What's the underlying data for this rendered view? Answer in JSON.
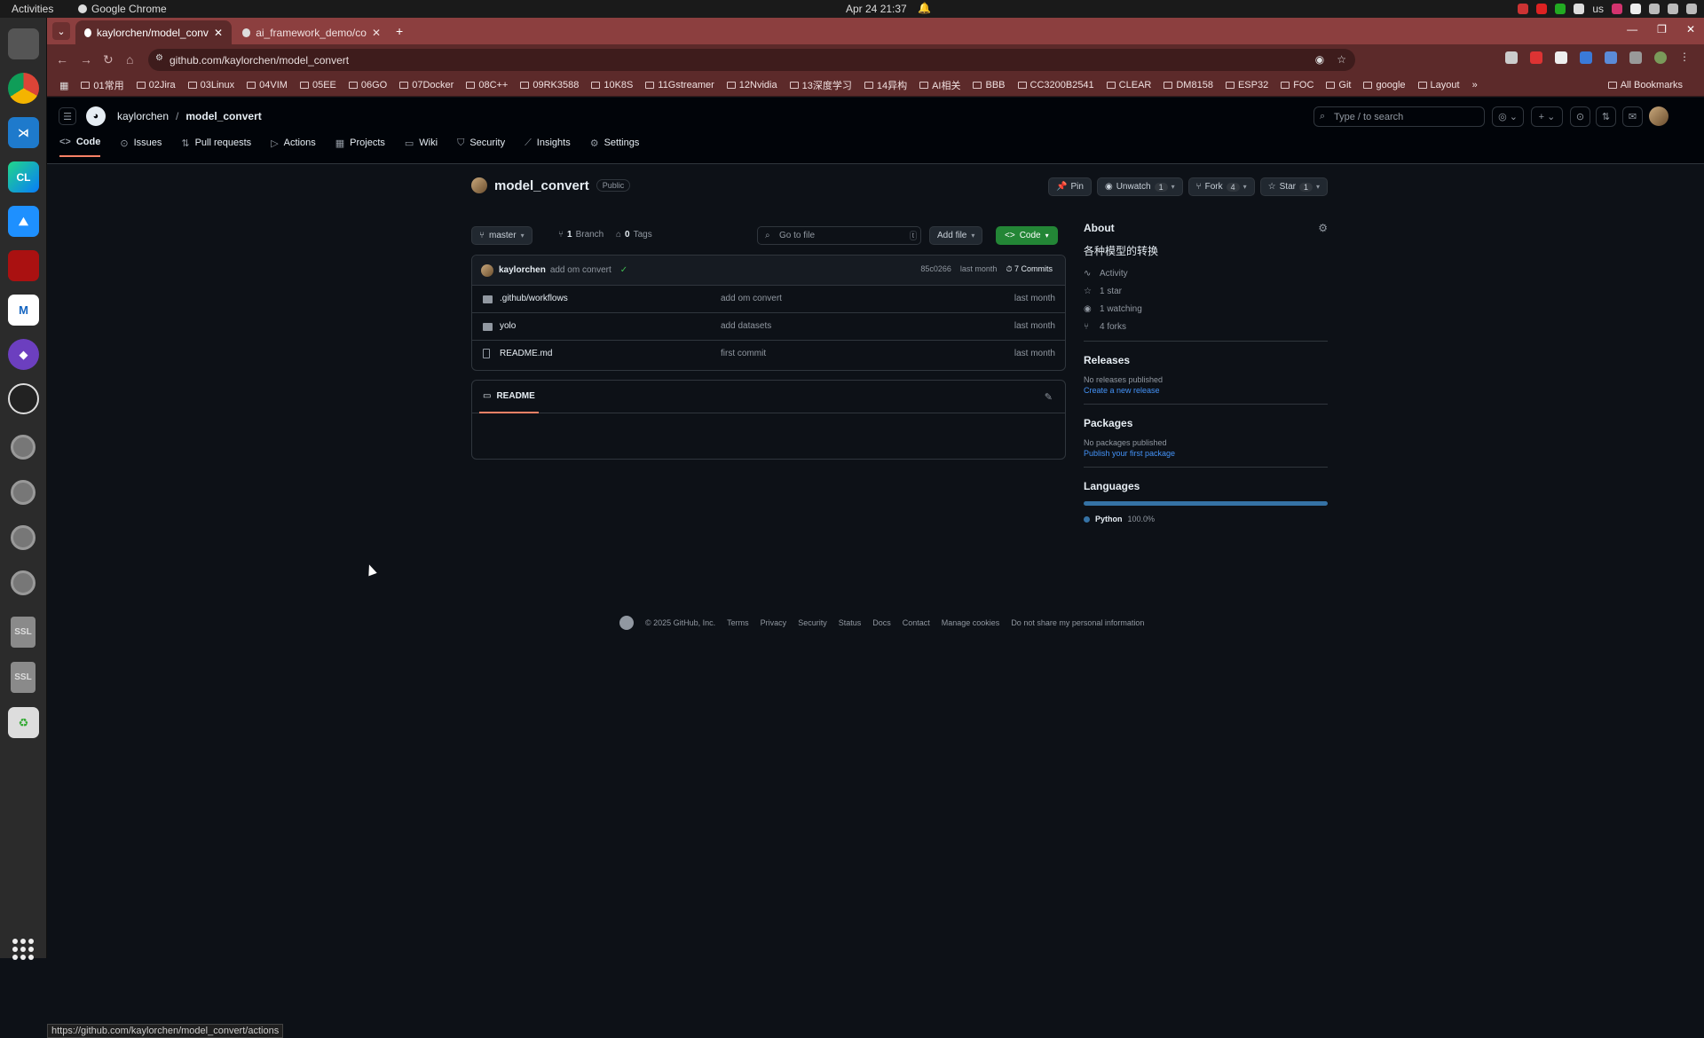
{
  "system_bar": {
    "activities": "Activities",
    "app_name": "Google Chrome",
    "clock": "Apr 24  21:37",
    "keyboard": "us"
  },
  "browser": {
    "tabs": [
      {
        "label": "kaylorchen/model_conv"
      },
      {
        "label": "ai_framework_demo/co"
      }
    ],
    "url": "github.com/kaylorchen/model_convert",
    "bookmarks": [
      "01常用",
      "02Jira",
      "03Linux",
      "04VIM",
      "05EE",
      "06GO",
      "07Docker",
      "08C++",
      "09RK3588",
      "10K8S",
      "11Gstreamer",
      "12Nvidia",
      "13深度学习",
      "14异构",
      "AI相关",
      "BBB",
      "CC3200B2541",
      "CLEAR",
      "DM8158",
      "ESP32",
      "FOC",
      "Git",
      "google",
      "Layout"
    ],
    "all_bookmarks": "All Bookmarks",
    "status_url": "https://github.com/kaylorchen/model_convert/actions"
  },
  "github": {
    "owner": "kaylorchen",
    "repo": "model_convert",
    "search_placeholder": "Type / to search",
    "tabs": [
      "Code",
      "Issues",
      "Pull requests",
      "Actions",
      "Projects",
      "Wiki",
      "Security",
      "Insights",
      "Settings"
    ],
    "visibility": "Public",
    "pin": "Pin",
    "unwatch": "Unwatch",
    "watch_count": "1",
    "fork": "Fork",
    "fork_count": "4",
    "star": "Star",
    "star_count": "1",
    "branch": "master",
    "branches_count": "1",
    "branches_label": "Branch",
    "tags_count": "0",
    "tags_label": "Tags",
    "goto_file": "Go to file",
    "add_file": "Add file",
    "code_button": "Code",
    "last_commit": {
      "user": "kaylorchen",
      "message": "add om convert",
      "hash": "85c0266",
      "time": "last month",
      "commits": "7 Commits"
    },
    "files": [
      {
        "name": ".github/workflows",
        "commit": "add om convert",
        "time": "last month",
        "type": "folder"
      },
      {
        "name": "yolo",
        "commit": "add datasets",
        "time": "last month",
        "type": "folder"
      },
      {
        "name": "README.md",
        "commit": "first commit",
        "time": "last month",
        "type": "file"
      }
    ],
    "readme_label": "README",
    "about": {
      "title": "About",
      "description": "各种模型的转换",
      "activity": "Activity",
      "stars": "1 star",
      "watching": "1 watching",
      "forks": "4 forks"
    },
    "releases": {
      "title": "Releases",
      "empty": "No releases published",
      "link": "Create a new release"
    },
    "packages": {
      "title": "Packages",
      "empty": "No packages published",
      "link": "Publish your first package"
    },
    "languages": {
      "title": "Languages",
      "name": "Python",
      "percent": "100.0%",
      "fraction": 1.0,
      "color": "#3572a5"
    },
    "footer": [
      "© 2025 GitHub, Inc.",
      "Terms",
      "Privacy",
      "Security",
      "Status",
      "Docs",
      "Contact",
      "Manage cookies",
      "Do not share my personal information"
    ]
  }
}
